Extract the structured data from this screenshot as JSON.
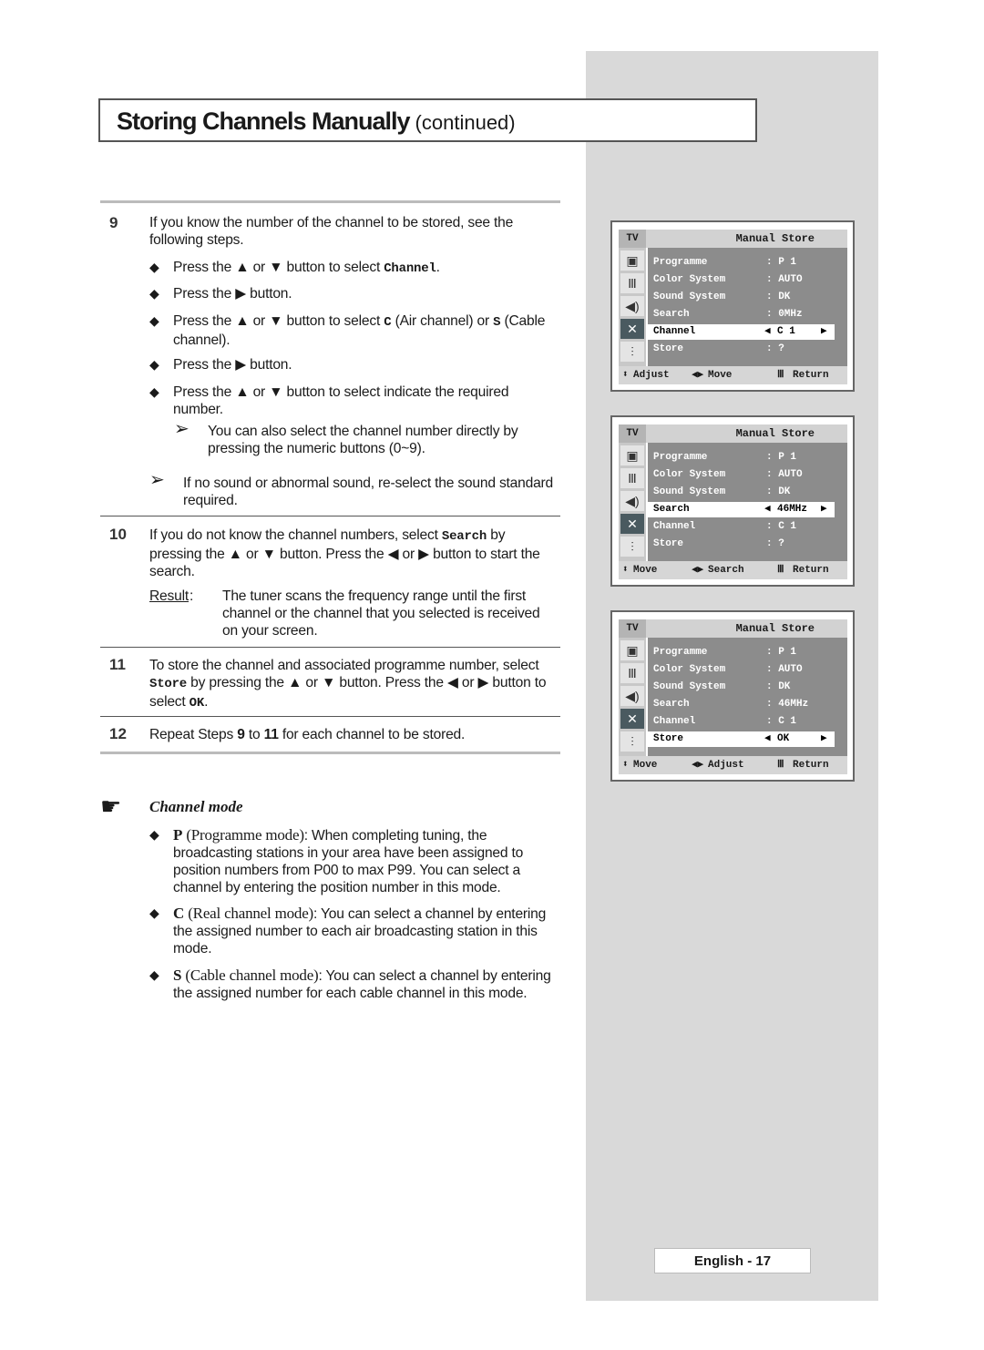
{
  "title": "Storing Channels Manually",
  "title_suffix": "(continued)",
  "steps": {
    "s9": {
      "num": "9",
      "intro": "If you know the number of the channel to be stored, see the following steps.",
      "b1a": "Press the ▲ or ▼ button to select ",
      "b1code": "Channel",
      "b1b": ".",
      "b2": "Press the ▶ button.",
      "b3a": "Press the ▲ or ▼ button to select ",
      "b3c": "C",
      "b3b": " (Air channel) or ",
      "b3s": "S",
      "b3d": " (Cable channel).",
      "b4": "Press the ▶ button.",
      "b5": "Press the ▲ or ▼ button to select indicate the required number.",
      "note1": "You can also select the channel number directly by pressing the numeric buttons (0~9).",
      "note2": "If no sound or abnormal sound, re-select the sound standard required."
    },
    "s10": {
      "num": "10",
      "a": "If you do not know the channel numbers, select ",
      "code": "Search",
      "b": " by pressing the ▲ or ▼ button. Press the ◀ or ▶ button to start the search.",
      "result_label": "Result",
      "result_colon": ":",
      "result": "The tuner scans the frequency range until the first channel or the channel that you selected is received on your screen."
    },
    "s11": {
      "num": "11",
      "a": "To store the channel and associated programme number, select ",
      "code": "Store",
      "b": " by pressing the ▲ or ▼ button. Press the ◀ or ▶ button to select ",
      "code2": "OK",
      "c": "."
    },
    "s12": {
      "num": "12",
      "a": "Repeat Steps ",
      "n1": "9",
      "b": " to ",
      "n2": "11",
      "c": " for each channel to be stored."
    }
  },
  "channel_mode": {
    "heading": "Channel mode",
    "items": [
      {
        "key": "P",
        "mode": "(Programme mode)",
        "text": ": When completing tuning, the broadcasting stations in your area have been assigned to position numbers from P00 to max P99. You can select a channel by entering the position number in this mode."
      },
      {
        "key": "C",
        "mode": "(Real channel mode)",
        "text": ": You can select a channel by entering the assigned number to each air broadcasting station in this mode."
      },
      {
        "key": "S",
        "mode": "(Cable channel mode)",
        "text": ": You can select a channel by entering the assigned number for each cable channel in this mode."
      }
    ]
  },
  "menus": [
    {
      "tv": "TV",
      "title": "Manual Store",
      "rows": [
        [
          "Programme",
          ": P 1"
        ],
        [
          "Color System",
          ": AUTO"
        ],
        [
          "Sound System",
          ": DK"
        ],
        [
          "Search",
          ":  0MHz"
        ],
        [
          "Channel",
          "C 1"
        ],
        [
          "Store",
          ": ?"
        ]
      ],
      "hl": 4,
      "foot": [
        "Adjust",
        "Move",
        "Return"
      ]
    },
    {
      "tv": "TV",
      "title": "Manual Store",
      "rows": [
        [
          "Programme",
          ": P 1"
        ],
        [
          "Color System",
          ": AUTO"
        ],
        [
          "Sound System",
          ": DK"
        ],
        [
          "Search",
          " 46MHz"
        ],
        [
          "Channel",
          ": C 1"
        ],
        [
          "Store",
          ": ?"
        ]
      ],
      "hl": 3,
      "foot": [
        "Move",
        "Search",
        "Return"
      ]
    },
    {
      "tv": "TV",
      "title": "Manual Store",
      "rows": [
        [
          "Programme",
          ": P 1"
        ],
        [
          "Color System",
          ": AUTO"
        ],
        [
          "Sound System",
          ": DK"
        ],
        [
          "Search",
          ":  46MHz"
        ],
        [
          "Channel",
          ": C 1"
        ],
        [
          "Store",
          "OK"
        ]
      ],
      "hl": 5,
      "foot": [
        "Move",
        "Adjust",
        "Return"
      ]
    }
  ],
  "footer": {
    "page": "English - 17"
  }
}
